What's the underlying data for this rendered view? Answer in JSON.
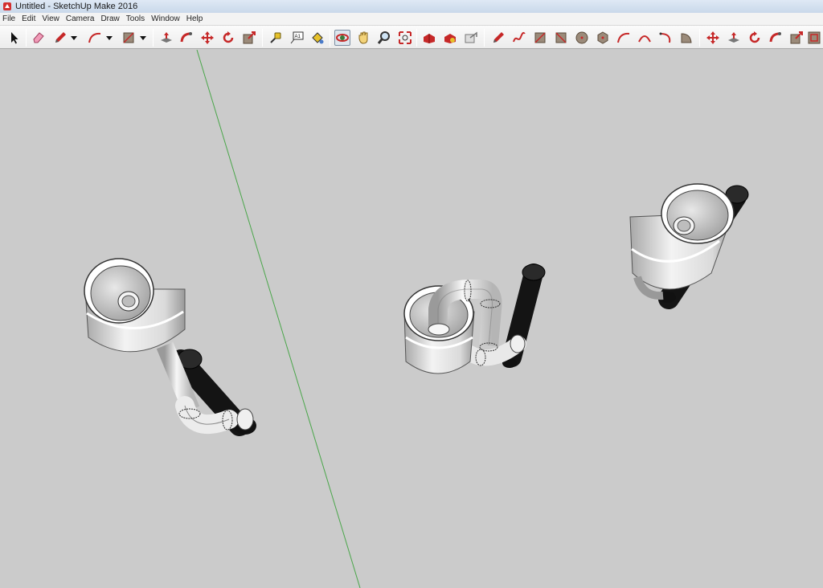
{
  "window": {
    "title": "Untitled - SketchUp Make 2016"
  },
  "menu": [
    "File",
    "Edit",
    "View",
    "Camera",
    "Draw",
    "Tools",
    "Window",
    "Help"
  ],
  "toolbar": {
    "tools": [
      {
        "name": "select-tool",
        "icon": "select-arrow-icon"
      },
      {
        "name": "eraser-tool",
        "icon": "eraser-icon"
      },
      {
        "name": "line-tool",
        "icon": "pencil-icon"
      },
      {
        "name": "line-dropdown",
        "icon": "dropdown-arrow-icon"
      },
      {
        "name": "arc-tool",
        "icon": "arc-icon"
      },
      {
        "name": "arc-dropdown",
        "icon": "dropdown-arrow-icon"
      },
      {
        "name": "rectangle-tool",
        "icon": "rectangle-icon"
      },
      {
        "name": "rectangle-dropdown",
        "icon": "dropdown-arrow-icon"
      },
      {
        "name": "push-pull-tool",
        "icon": "push-pull-icon"
      },
      {
        "name": "follow-me-tool",
        "icon": "follow-me-icon"
      },
      {
        "name": "move-tool",
        "icon": "move-icon"
      },
      {
        "name": "rotate-tool",
        "icon": "rotate-icon"
      },
      {
        "name": "scale-tool",
        "icon": "scale-icon"
      },
      {
        "name": "tape-measure-tool",
        "icon": "tape-measure-icon"
      },
      {
        "name": "text-tool",
        "icon": "text-icon"
      },
      {
        "name": "paint-bucket-tool",
        "icon": "paint-bucket-icon"
      },
      {
        "name": "orbit-tool",
        "icon": "orbit-icon"
      },
      {
        "name": "pan-tool",
        "icon": "pan-hand-icon"
      },
      {
        "name": "zoom-tool",
        "icon": "zoom-icon"
      },
      {
        "name": "zoom-extents-tool",
        "icon": "zoom-extents-icon"
      },
      {
        "name": "3d-warehouse-button",
        "icon": "warehouse-icon"
      },
      {
        "name": "extension-warehouse-button",
        "icon": "extension-icon"
      },
      {
        "name": "share-model-button",
        "icon": "share-model-icon"
      },
      {
        "name": "line-draw-tool",
        "icon": "pencil-icon"
      },
      {
        "name": "freehand-tool",
        "icon": "freehand-icon"
      },
      {
        "name": "rectangle-draw-tool",
        "icon": "rectangle-icon"
      },
      {
        "name": "rotated-rectangle-tool",
        "icon": "rotated-rectangle-icon"
      },
      {
        "name": "circle-tool",
        "icon": "circle-icon"
      },
      {
        "name": "polygon-tool",
        "icon": "polygon-icon"
      },
      {
        "name": "arc-draw-tool",
        "icon": "arc-icon"
      },
      {
        "name": "two-point-arc-tool",
        "icon": "two-point-arc-icon"
      },
      {
        "name": "three-point-arc-tool",
        "icon": "three-point-arc-icon"
      },
      {
        "name": "pie-tool",
        "icon": "pie-icon"
      },
      {
        "name": "move-edit-tool",
        "icon": "move-icon"
      },
      {
        "name": "push-pull-edit-tool",
        "icon": "push-pull-icon"
      },
      {
        "name": "rotate-edit-tool",
        "icon": "rotate-icon"
      },
      {
        "name": "follow-me-edit-tool",
        "icon": "follow-me-icon"
      },
      {
        "name": "scale-edit-tool",
        "icon": "scale-icon"
      },
      {
        "name": "offset-tool",
        "icon": "offset-icon"
      }
    ]
  },
  "colors": {
    "background": "#cbcbcb",
    "pipe_white": "#f4f4f4",
    "pipe_black": "#1b1b1b",
    "green_axis": "#4aa64a",
    "icon_red": "#c62828"
  }
}
